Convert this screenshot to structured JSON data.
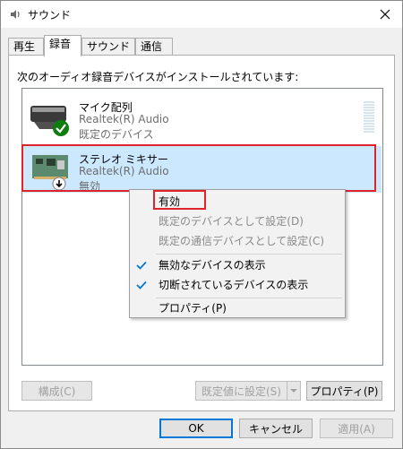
{
  "window": {
    "title": "サウンド"
  },
  "tabs": [
    {
      "label": "再生"
    },
    {
      "label": "録音"
    },
    {
      "label": "サウンド"
    },
    {
      "label": "通信"
    }
  ],
  "instruction": "次のオーディオ録音デバイスがインストールされています:",
  "devices": [
    {
      "name": "マイク配列",
      "driver": "Realtek(R) Audio",
      "status": "既定のデバイス"
    },
    {
      "name": "ステレオ ミキサー",
      "driver": "Realtek(R) Audio",
      "status": "無効"
    }
  ],
  "context_menu": {
    "items": [
      {
        "label": "有効"
      },
      {
        "label": "既定のデバイスとして設定(D)"
      },
      {
        "label": "既定の通信デバイスとして設定(C)"
      },
      {
        "label": "無効なデバイスの表示"
      },
      {
        "label": "切断されているデバイスの表示"
      },
      {
        "label": "プロパティ(P)"
      }
    ]
  },
  "buttons": {
    "configure": "構成(C)",
    "set_default": "既定値に設定(S)",
    "properties": "プロパティ(P)",
    "ok": "OK",
    "cancel": "キャンセル",
    "apply": "適用(A)"
  },
  "colors": {
    "highlight_box": "#e0232b",
    "selection": "#cce8ff",
    "check": "#0078d7"
  }
}
